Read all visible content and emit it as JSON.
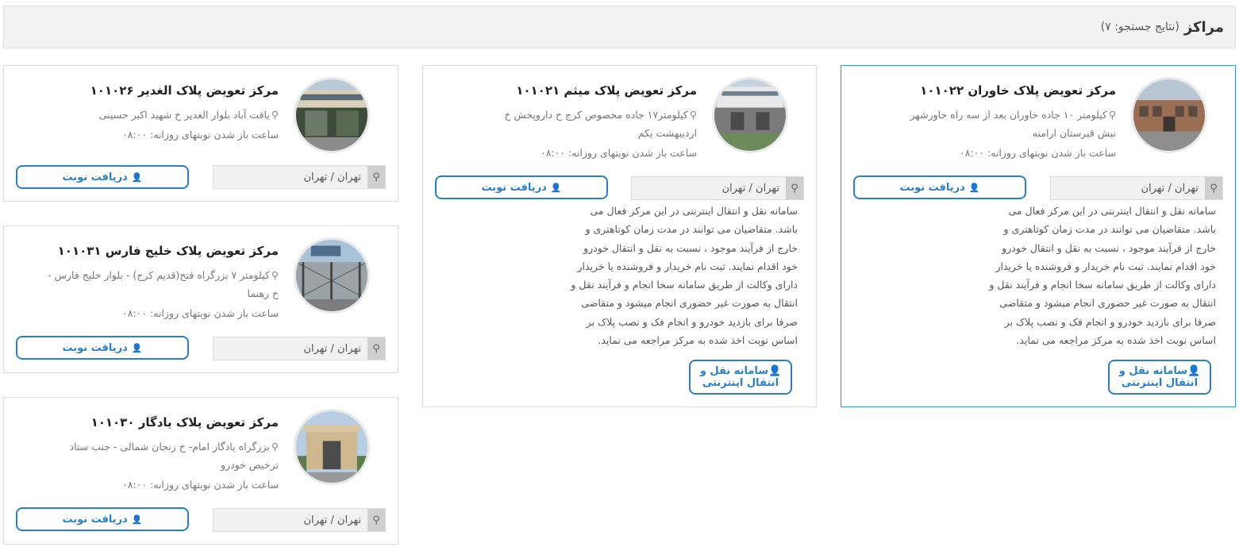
{
  "header": {
    "title": "مراکز",
    "subtitle": "(نتایج جستجو: ۷)"
  },
  "colors": {
    "accent": "#2a7fc8",
    "active_border": "#3a8fd0"
  },
  "labels": {
    "get_turn": "دریافت نوبت",
    "online_transfer": "سامانه نقل و انتقال اینترنتی",
    "location": "تهران / تهران",
    "hours_prefix": "ساعت باز شدن نوبتهای روزانه: ۰۸:۰۰"
  },
  "description": "سامانه نقل و انتقال اینترنتی در این مرکز فعال می باشد. متقاضیان می توانند در مدت زمان کوتاهتری و خارج از فرآیند موجود ، نسبت به نقل و انتقال خودرو خود اقدام نمایند. ثبت نام خریدار و فروشنده یا خریدار دارای وکالت از طریق سامانه سخا انجام و فرآیند نقل و انتقال به صورت غیر حضوری انجام میشود و متقاضی صرفا برای بازدید خودرو و انجام فک و نصب پلاک بر اساس نوبت اخذ شده به مرکز مراجعه می نماید.",
  "centers": [
    {
      "title": "مرکز تعویض پلاک خاوران ۱۰۱۰۲۲",
      "address": "کیلومتر ۱۰ جاده خاوران بعد از سه راه خاورشهر نبش قبرستان ارامنه",
      "photo": "building-photo"
    },
    {
      "title": "مرکز تعویض پلاک میثم ۱۰۱۰۲۱",
      "address": "کیلومتر۱۷ جاده مخصوص کرج خ داروپخش خ اردیبهشت یکم",
      "photo": "gate-photo"
    },
    {
      "title": "مرکز تعویض پلاک الغدیر ۱۰۱۰۲۶",
      "address": "یافت آباد بلوار الغدیر خ شهید اکبر حسینی",
      "photo": "gate-photo"
    },
    {
      "title": "مرکز تعویض پلاک خلیج فارس ۱۰۱۰۳۱",
      "address": "کیلومتر ۷ بزرگراه فتح(قدیم کرج) - بلوار خلیج فارس - خ رهنما",
      "photo": "fence-photo"
    },
    {
      "title": "مرکز تعویض پلاک یادگار ۱۰۱۰۳۰",
      "address": "بزرگراه یادگار امام- خ زنجان شمالی - جنب ستاد ترخیص خودرو",
      "photo": "entrance-photo"
    }
  ]
}
